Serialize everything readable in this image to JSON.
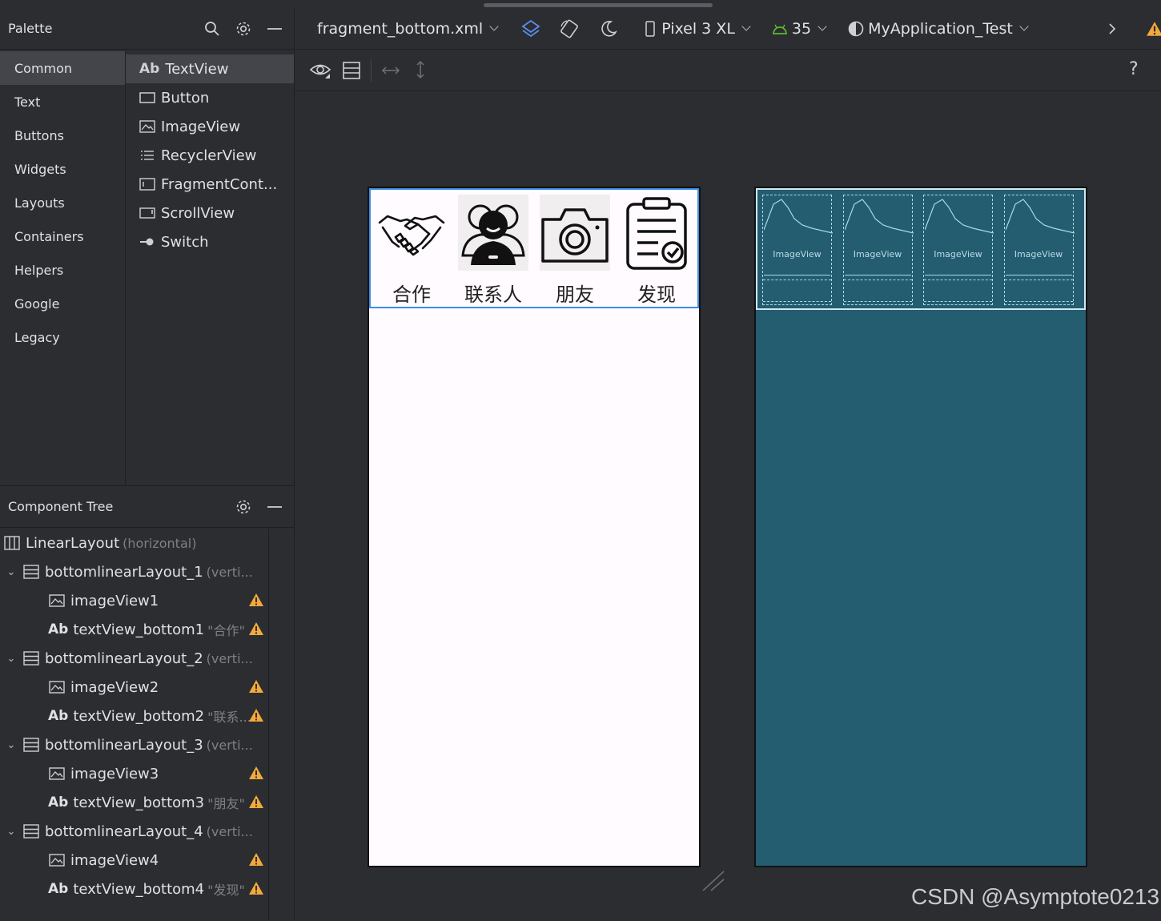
{
  "palette": {
    "title": "Palette",
    "categories": [
      "Common",
      "Text",
      "Buttons",
      "Widgets",
      "Layouts",
      "Containers",
      "Helpers",
      "Google",
      "Legacy"
    ],
    "items": [
      {
        "icon": "ab-text-icon",
        "glyph": "Ab",
        "label": "TextView"
      },
      {
        "icon": "button-icon",
        "label": "Button"
      },
      {
        "icon": "image-icon",
        "label": "ImageView"
      },
      {
        "icon": "list-icon",
        "label": "RecyclerView"
      },
      {
        "icon": "fragment-icon",
        "label": "FragmentCont..."
      },
      {
        "icon": "scroll-icon",
        "label": "ScrollView"
      },
      {
        "icon": "switch-icon",
        "label": "Switch"
      }
    ]
  },
  "component_tree": {
    "title": "Component Tree",
    "rows": [
      {
        "name": "LinearLayout",
        "hint": "(horizontal)"
      },
      {
        "name": "bottomlinearLayout_1",
        "hint": "(verti..."
      },
      {
        "name": "imageView1",
        "hint": ""
      },
      {
        "name": "textView_bottom1",
        "hint": "\"合作\""
      },
      {
        "name": "bottomlinearLayout_2",
        "hint": "(verti..."
      },
      {
        "name": "imageView2",
        "hint": ""
      },
      {
        "name": "textView_bottom2",
        "hint": "\"联系..."
      },
      {
        "name": "bottomlinearLayout_3",
        "hint": "(verti..."
      },
      {
        "name": "imageView3",
        "hint": ""
      },
      {
        "name": "textView_bottom3",
        "hint": "\"朋友\""
      },
      {
        "name": "bottomlinearLayout_4",
        "hint": "(verti..."
      },
      {
        "name": "imageView4",
        "hint": ""
      },
      {
        "name": "textView_bottom4",
        "hint": "\"发现\""
      }
    ],
    "text_glyph": "Ab"
  },
  "toolbar": {
    "file": "fragment_bottom.xml",
    "device": "Pixel 3 XL",
    "api": "35",
    "theme": "MyApplication_Test",
    "help": "?"
  },
  "design": {
    "tabs": [
      "合作",
      "联系人",
      "朋友",
      "发现"
    ],
    "icons": [
      "handshake-icon",
      "contacts-icon",
      "camera-icon",
      "clipboard-icon"
    ]
  },
  "blueprint": {
    "placeholder": "ImageView"
  },
  "colors": {
    "warning": "#f2a93b",
    "selection": "#3d8ee6",
    "blueprint_bg": "#245c70"
  },
  "watermark": "CSDN @Asymptote0213"
}
